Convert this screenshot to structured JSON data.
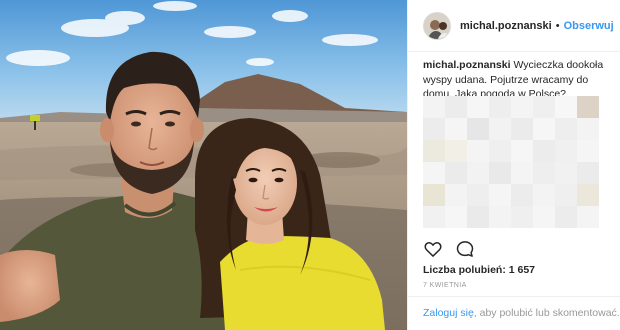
{
  "post": {
    "username": "michal.poznanski",
    "separator": "•",
    "follow_label": "Obserwuj",
    "caption_username": "michal.poznanski",
    "caption_text": "Wycieczka dookoła wyspy udana. Pojutrze wracamy do domu. Jaka pogoda w Polsce?",
    "likes_text": "Liczba polubień: 1 657",
    "date": "7 KWIETNIA",
    "login_link": "Zaloguj się",
    "login_rest": ", aby polubić lub skomentować."
  },
  "icons": {
    "like": "heart-outline-icon",
    "comment": "speech-bubble-icon"
  },
  "colors": {
    "accent": "#3897f0",
    "text": "#262626",
    "muted": "#999999",
    "divider": "#efefef"
  }
}
